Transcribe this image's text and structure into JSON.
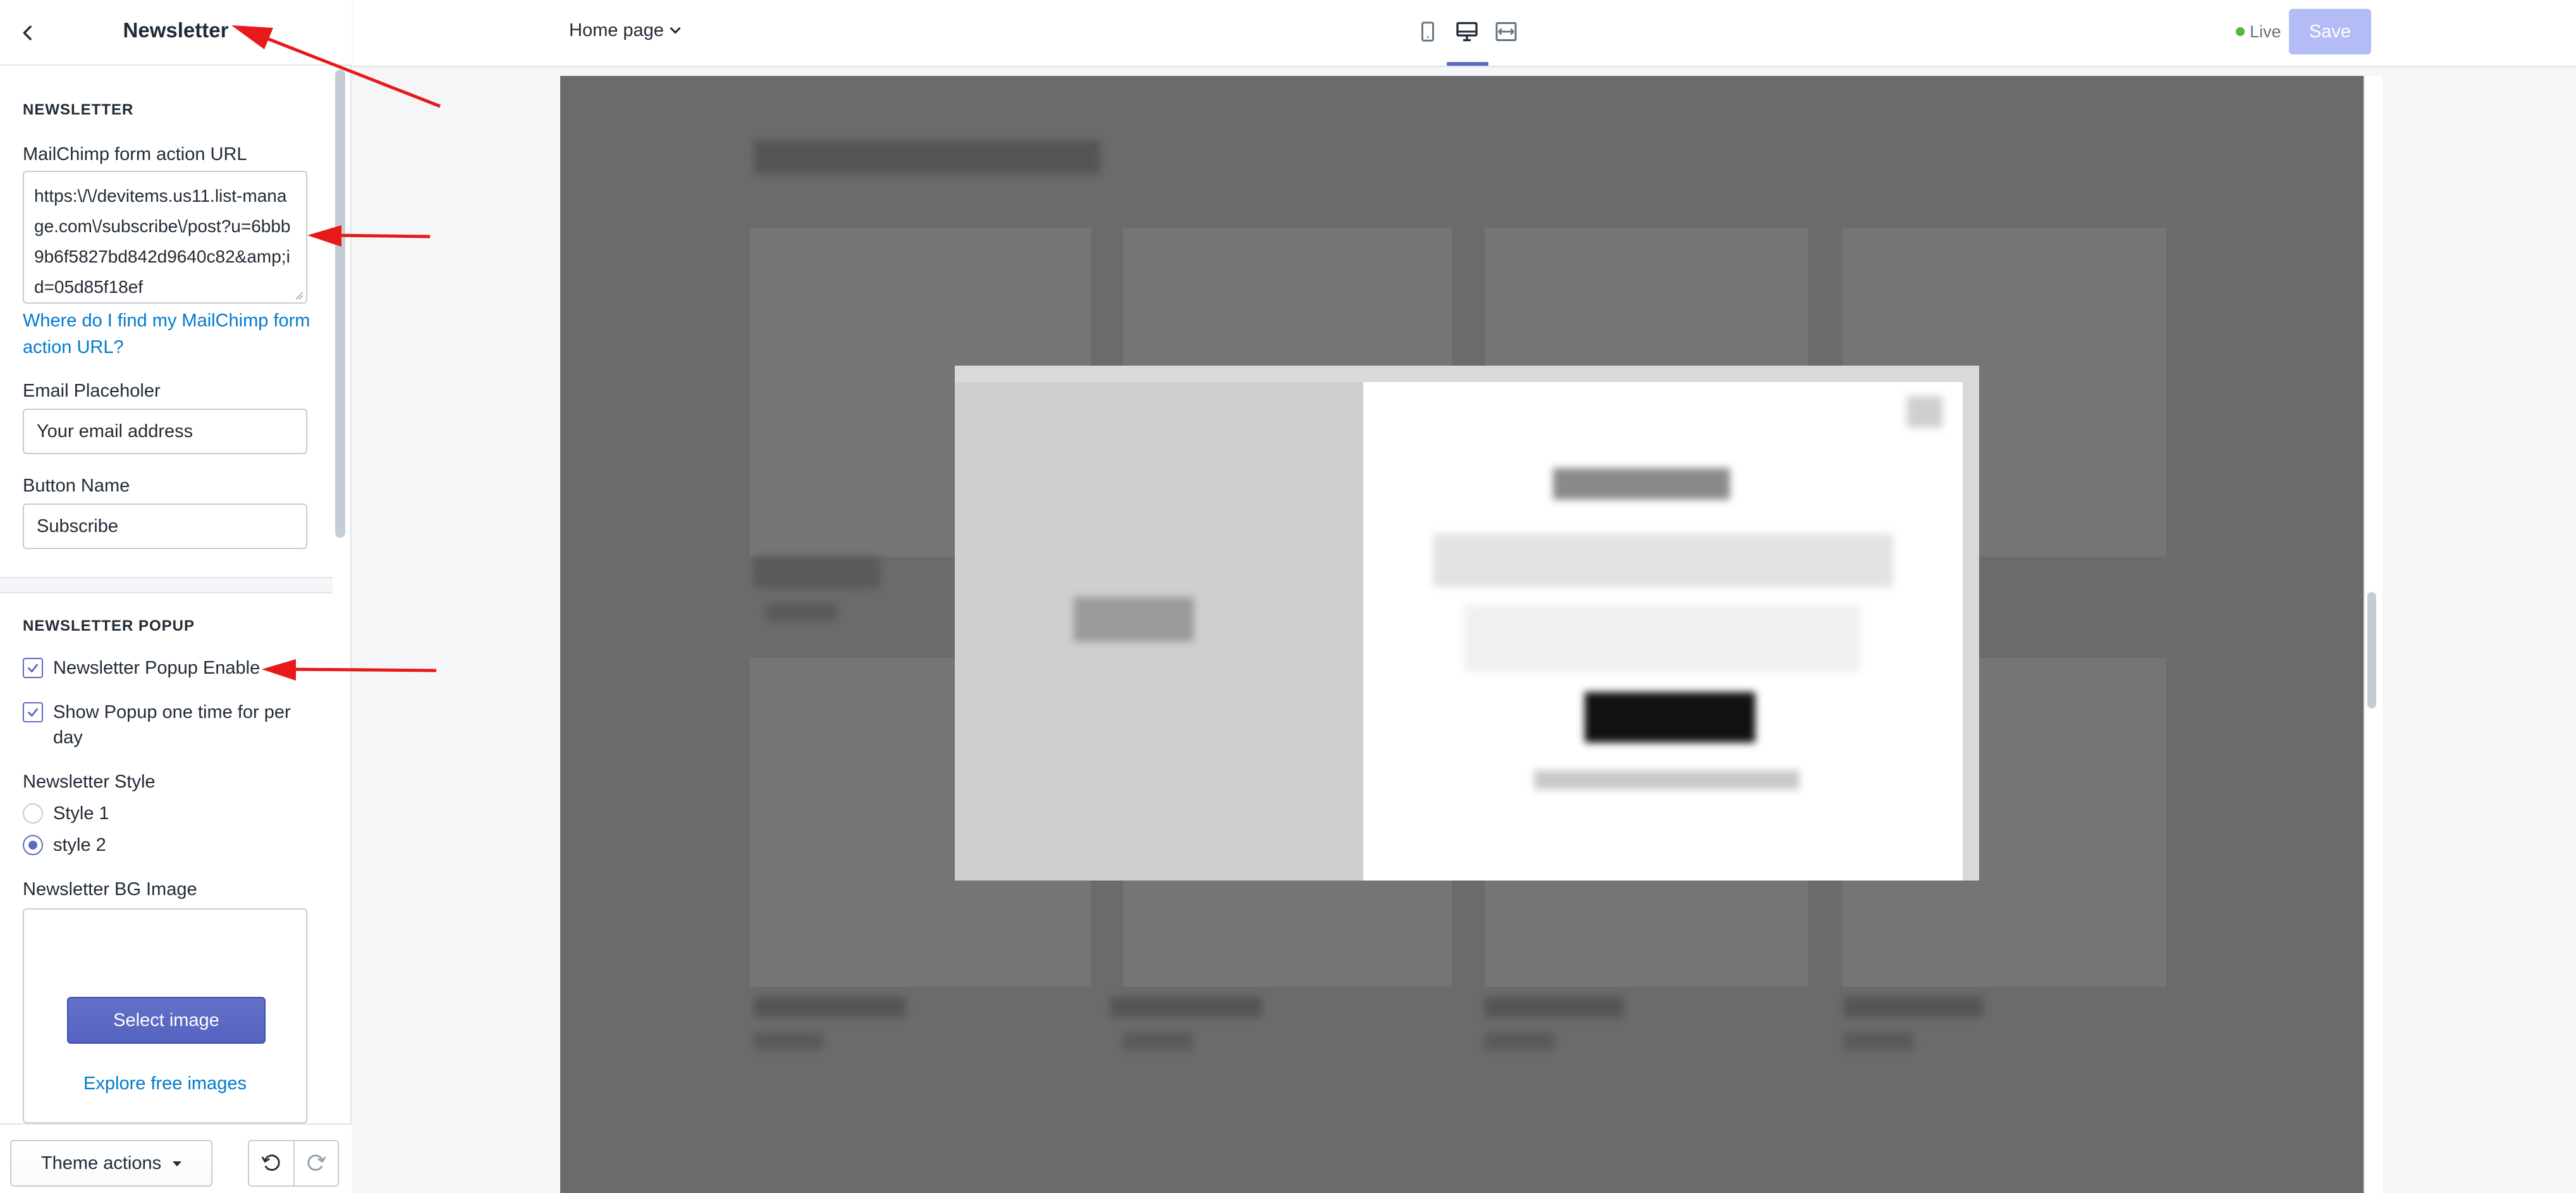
{
  "sidebar": {
    "title": "Newsletter",
    "sections": {
      "newsletter": {
        "heading": "NEWSLETTER",
        "mailchimp_label": "MailChimp form action URL",
        "mailchimp_value": "https:\\/\\/devitems.us11.list-manage.com\\/subscribe\\/post?u=6bbb9b6f5827bd842d9640c82&amp;id=05d85f18ef",
        "help_link": "Where do I find my MailChimp form action URL?",
        "email_label": "Email Placeholer",
        "email_value": "Your email address",
        "button_label": "Button Name",
        "button_value": "Subscribe"
      },
      "popup": {
        "heading": "NEWSLETTER POPUP",
        "enable_label": "Newsletter Popup Enable",
        "enable_checked": true,
        "once_label": "Show Popup one time for per day",
        "once_checked": true,
        "style_label": "Newsletter Style",
        "style_options": [
          "Style 1",
          "style 2"
        ],
        "style_selected": "style 2",
        "bg_label": "Newsletter BG Image",
        "select_image": "Select image",
        "explore": "Explore free images"
      }
    },
    "footer": {
      "theme_actions": "Theme actions"
    }
  },
  "topbar": {
    "page": "Home page",
    "devices": [
      "mobile-icon",
      "desktop-icon",
      "fullwidth-icon"
    ],
    "active_device": "desktop-icon",
    "status": "Live",
    "save": "Save"
  },
  "colors": {
    "accent": "#5c6ac4",
    "link": "#007ace",
    "live": "#50b83c",
    "annotation": "#e8191a"
  }
}
